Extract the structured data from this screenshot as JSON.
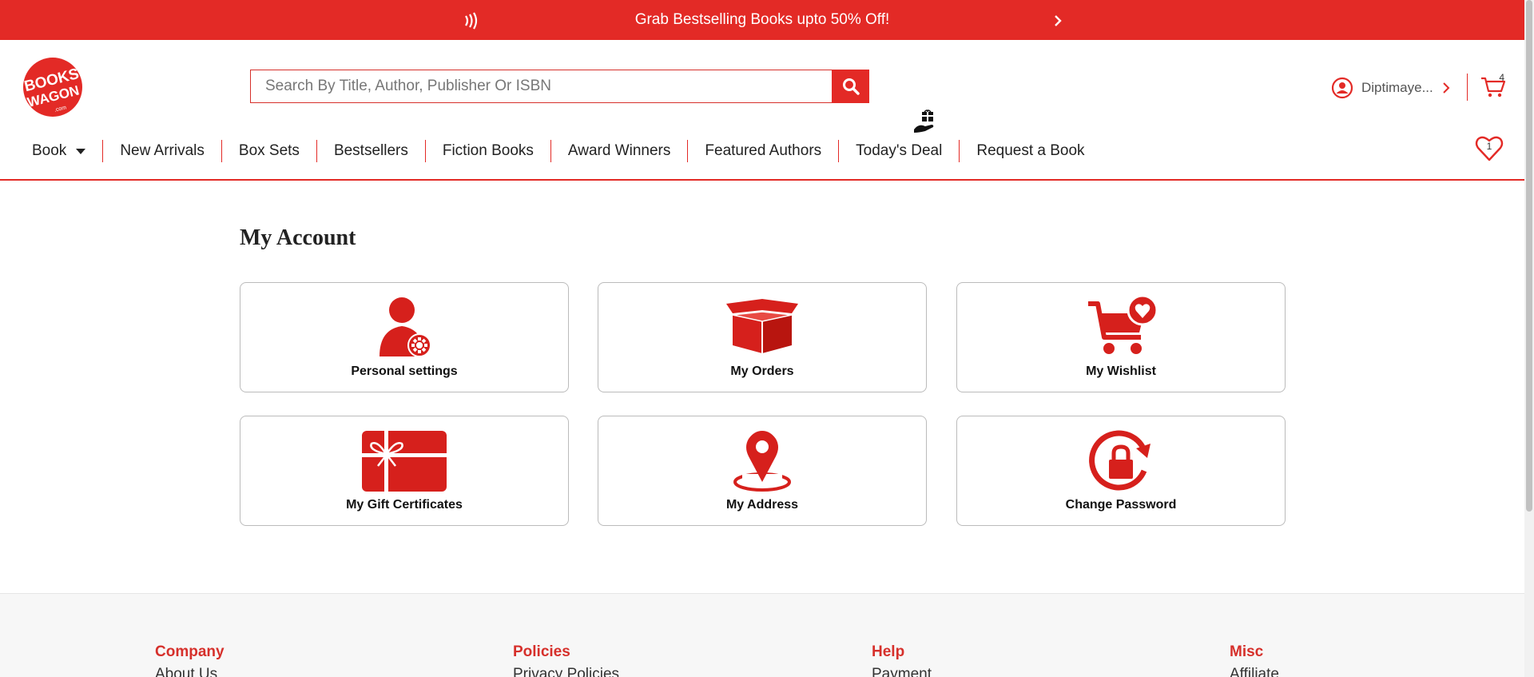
{
  "promo": {
    "message": "Grab Bestselling Books upto 50% Off!",
    "pause_icon": "pause-sound-icon",
    "next_icon": "chevron-right-icon"
  },
  "header": {
    "logo_text_top": "BOOKS",
    "logo_text_bottom": "WAGON",
    "logo_sub": ".com",
    "search": {
      "placeholder": "Search By Title, Author, Publisher Or ISBN",
      "value": ""
    },
    "user_name": "Diptimaye...",
    "cart_count": "4",
    "wishlist_count": "1"
  },
  "nav": {
    "items": [
      "Book",
      "New Arrivals",
      "Box Sets",
      "Bestsellers",
      "Fiction Books",
      "Award Winners",
      "Featured Authors",
      "Today's Deal",
      "Request a Book"
    ]
  },
  "account": {
    "title": "My Account",
    "tiles": [
      {
        "label": "Personal settings",
        "icon": "user-settings-icon"
      },
      {
        "label": "My Orders",
        "icon": "open-box-icon"
      },
      {
        "label": "My Wishlist",
        "icon": "cart-heart-icon"
      },
      {
        "label": "My Gift Certificates",
        "icon": "gift-card-icon"
      },
      {
        "label": "My Address",
        "icon": "map-pin-icon"
      },
      {
        "label": "Change Password",
        "icon": "lock-refresh-icon"
      }
    ]
  },
  "footer": {
    "columns": [
      {
        "heading": "Company",
        "first_link": "About Us"
      },
      {
        "heading": "Policies",
        "first_link": "Privacy Policies"
      },
      {
        "heading": "Help",
        "first_link": "Payment"
      },
      {
        "heading": "Misc",
        "first_link": "Affiliate"
      }
    ]
  },
  "colors": {
    "brand_red": "#e32a26",
    "text_dark": "#222222",
    "tile_border": "#bbbbbb"
  }
}
